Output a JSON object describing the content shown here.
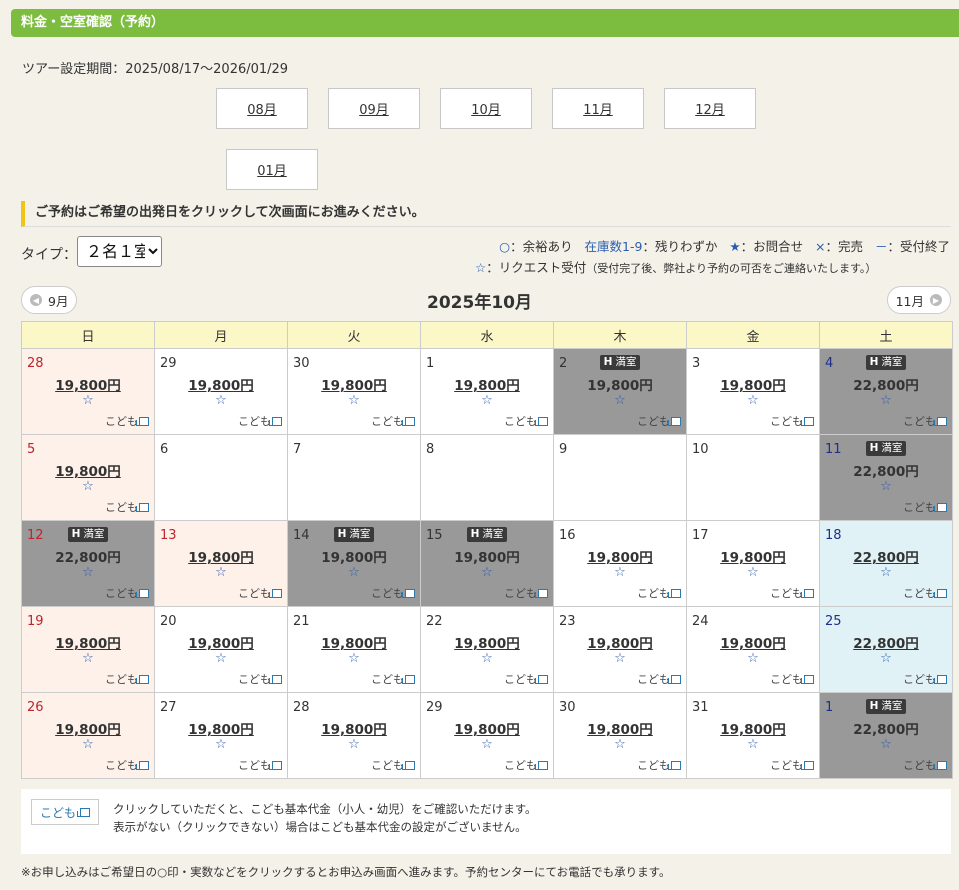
{
  "header": {
    "title": "料金・空室確認（予約）"
  },
  "tour_period": "ツアー設定期間：2025/08/17～2026/01/29",
  "months": [
    "08月",
    "09月",
    "10月",
    "11月",
    "12月",
    "01月"
  ],
  "notice": "ご予約はご希望の出発日をクリックして次画面にお進みください。",
  "type_selector": {
    "label": "タイプ：",
    "selected": "２名１室"
  },
  "legend": {
    "line1": [
      {
        "symbol": "○",
        "text": "：余裕あり"
      },
      {
        "symbol": "在庫数1-9",
        "text": "：残りわずか"
      },
      {
        "symbol": "★",
        "text": "：お問合せ"
      },
      {
        "symbol": "×",
        "text": "：完売"
      },
      {
        "symbol": "－",
        "text": "：受付終了"
      }
    ],
    "line2_symbol": "☆",
    "line2_text": "：リクエスト受付",
    "line2_note": "（受付完了後、弊社より予約の可否をご連絡いたします。）"
  },
  "nav": {
    "prev": "9月",
    "next": "11月"
  },
  "calendar_title": "2025年10月",
  "weekdays": [
    "日",
    "月",
    "火",
    "水",
    "木",
    "金",
    "土"
  ],
  "full_label": "満室",
  "hotel_mark": "H",
  "kodomo_label": "こども",
  "weeks": [
    [
      {
        "day": "28",
        "type": "hol",
        "price": "19,800円",
        "star": "☆",
        "kids": true
      },
      {
        "day": "29",
        "type": "normal",
        "price": "19,800円",
        "star": "☆",
        "kids": true
      },
      {
        "day": "30",
        "type": "normal",
        "price": "19,800円",
        "star": "☆",
        "kids": true
      },
      {
        "day": "1",
        "type": "normal",
        "price": "19,800円",
        "star": "☆",
        "kids": true
      },
      {
        "day": "2",
        "type": "full",
        "price": "19,800円",
        "star": "☆",
        "kids": true
      },
      {
        "day": "3",
        "type": "normal",
        "price": "19,800円",
        "star": "☆",
        "kids": true
      },
      {
        "day": "4",
        "type": "full",
        "price": "22,800円",
        "star": "☆",
        "kids": true,
        "daycolor": "navy"
      }
    ],
    [
      {
        "day": "5",
        "type": "hol",
        "price": "19,800円",
        "star": "☆",
        "kids": true
      },
      {
        "day": "6",
        "type": "empty"
      },
      {
        "day": "7",
        "type": "empty"
      },
      {
        "day": "8",
        "type": "empty"
      },
      {
        "day": "9",
        "type": "empty"
      },
      {
        "day": "10",
        "type": "empty"
      },
      {
        "day": "11",
        "type": "full",
        "price": "22,800円",
        "star": "☆",
        "kids": true,
        "daycolor": "navy"
      }
    ],
    [
      {
        "day": "12",
        "type": "full",
        "price": "22,800円",
        "star": "☆",
        "kids": true,
        "daycolor": "red"
      },
      {
        "day": "13",
        "type": "hol",
        "price": "19,800円",
        "star": "☆",
        "kids": true
      },
      {
        "day": "14",
        "type": "full",
        "price": "19,800円",
        "star": "☆",
        "kids": true
      },
      {
        "day": "15",
        "type": "full",
        "price": "19,800円",
        "star": "☆",
        "kids": true
      },
      {
        "day": "16",
        "type": "normal",
        "price": "19,800円",
        "star": "☆",
        "kids": true
      },
      {
        "day": "17",
        "type": "normal",
        "price": "19,800円",
        "star": "☆",
        "kids": true
      },
      {
        "day": "18",
        "type": "sat",
        "price": "22,800円",
        "star": "☆",
        "kids": true
      }
    ],
    [
      {
        "day": "19",
        "type": "hol",
        "price": "19,800円",
        "star": "☆",
        "kids": true
      },
      {
        "day": "20",
        "type": "normal",
        "price": "19,800円",
        "star": "☆",
        "kids": true
      },
      {
        "day": "21",
        "type": "normal",
        "price": "19,800円",
        "star": "☆",
        "kids": true
      },
      {
        "day": "22",
        "type": "normal",
        "price": "19,800円",
        "star": "☆",
        "kids": true
      },
      {
        "day": "23",
        "type": "normal",
        "price": "19,800円",
        "star": "☆",
        "kids": true
      },
      {
        "day": "24",
        "type": "normal",
        "price": "19,800円",
        "star": "☆",
        "kids": true
      },
      {
        "day": "25",
        "type": "sat",
        "price": "22,800円",
        "star": "☆",
        "kids": true
      }
    ],
    [
      {
        "day": "26",
        "type": "hol",
        "price": "19,800円",
        "star": "☆",
        "kids": true
      },
      {
        "day": "27",
        "type": "normal",
        "price": "19,800円",
        "star": "☆",
        "kids": true
      },
      {
        "day": "28",
        "type": "normal",
        "price": "19,800円",
        "star": "☆",
        "kids": true
      },
      {
        "day": "29",
        "type": "normal",
        "price": "19,800円",
        "star": "☆",
        "kids": true
      },
      {
        "day": "30",
        "type": "normal",
        "price": "19,800円",
        "star": "☆",
        "kids": true
      },
      {
        "day": "31",
        "type": "normal",
        "price": "19,800円",
        "star": "☆",
        "kids": true
      },
      {
        "day": "1",
        "type": "full",
        "price": "22,800円",
        "star": "☆",
        "kids": true,
        "daycolor": "navy"
      }
    ]
  ],
  "info": {
    "button": "こども",
    "line1": "クリックしていただくと、こども基本代金（小人・幼児）をご確認いただけます。",
    "line2": "表示がない（クリックできない）場合はこども基本代金の設定がございません。"
  },
  "footer_note": "※お申し込みはご希望日の○印・実数などをクリックするとお申込み画面へ進みます。予約センターにてお電話でも承ります。",
  "colors": {
    "header_green": "#7cbd3f",
    "full_gray": "#999999",
    "holiday_bg": "#fdf1ea",
    "saturday_bg": "#e1f2f7",
    "weekday_header_bg": "#fbf7c6",
    "link_blue": "#2a5db0"
  }
}
